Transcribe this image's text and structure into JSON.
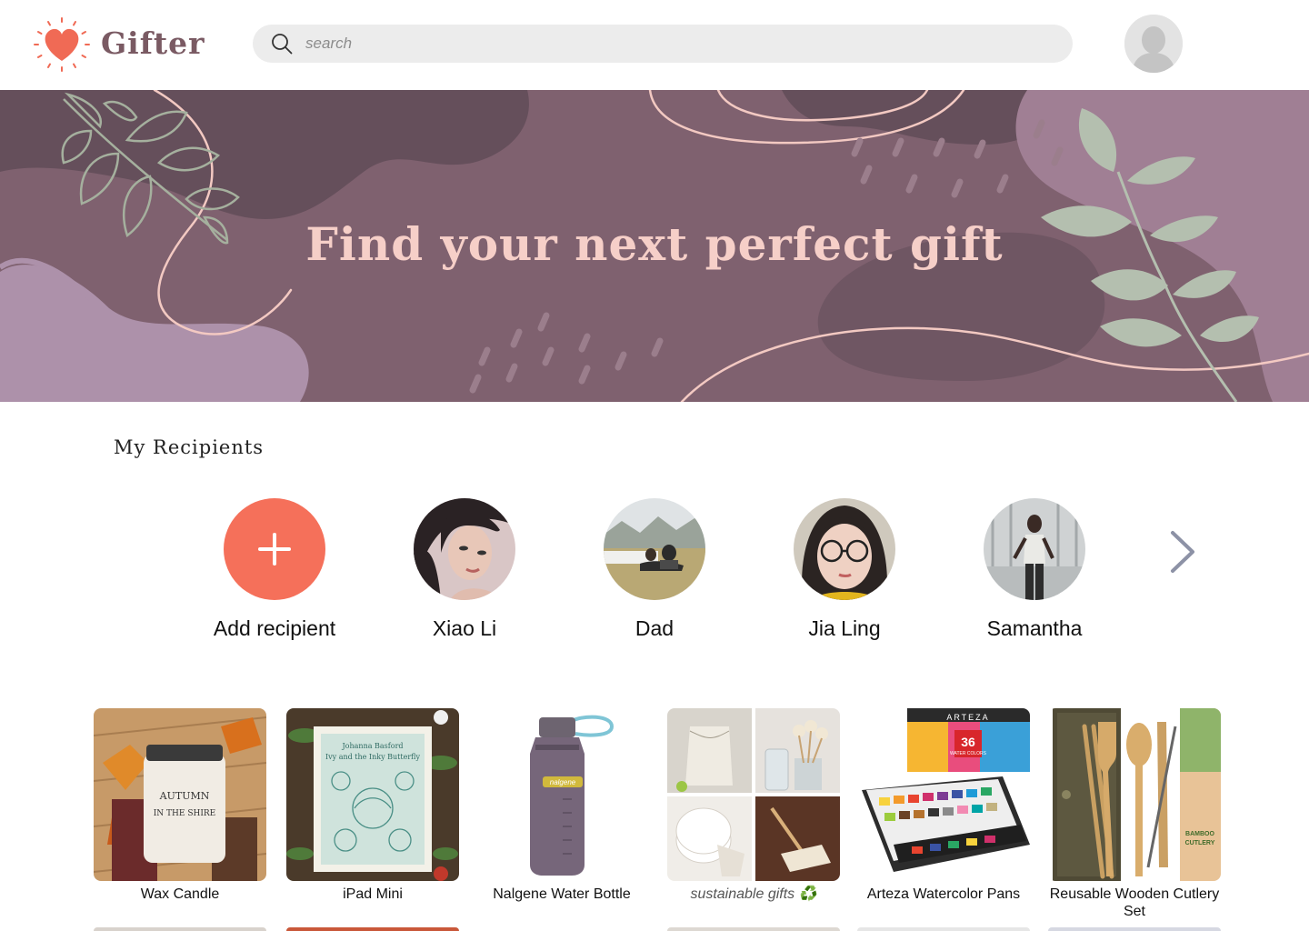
{
  "header": {
    "brand": "Gifter",
    "search_placeholder": "search"
  },
  "hero": {
    "title": "Find your next perfect gift"
  },
  "recipients": {
    "title": "My Recipients",
    "add_label": "Add recipient",
    "items": [
      {
        "name": "Xiao Li"
      },
      {
        "name": "Dad"
      },
      {
        "name": "Jia Ling"
      },
      {
        "name": "Samantha"
      }
    ]
  },
  "products": [
    {
      "label": "Wax Candle",
      "jar_lines": [
        "AUTUMN",
        "IN THE SHIRE"
      ]
    },
    {
      "label": "iPad Mini",
      "cover_lines": [
        "Johanna Basford",
        "Ivy and the Inky Butterfly"
      ]
    },
    {
      "label": "Nalgene Water Bottle",
      "brand": "nalgene"
    },
    {
      "label": "sustainable gifts ♻️"
    },
    {
      "label": "Arteza Watercolor Pans",
      "box_brand": "ARTEZA",
      "box_count": "36",
      "box_text": "WATER COLORS"
    },
    {
      "label": "Reusable Wooden Cutlery Set",
      "pack_text": [
        "BAMBOO",
        "CUTLERY"
      ]
    }
  ],
  "colors": {
    "brand": "#7a5a63",
    "accent": "#f5705a",
    "hero_bg": "#7f616f",
    "hero_text": "#f6cfc8",
    "leaf": "#b4bfaf"
  },
  "icons": {
    "logo": "heart-icon",
    "search": "search-icon",
    "avatar": "user-avatar-icon",
    "add": "plus-icon",
    "next": "chevron-right-icon"
  }
}
